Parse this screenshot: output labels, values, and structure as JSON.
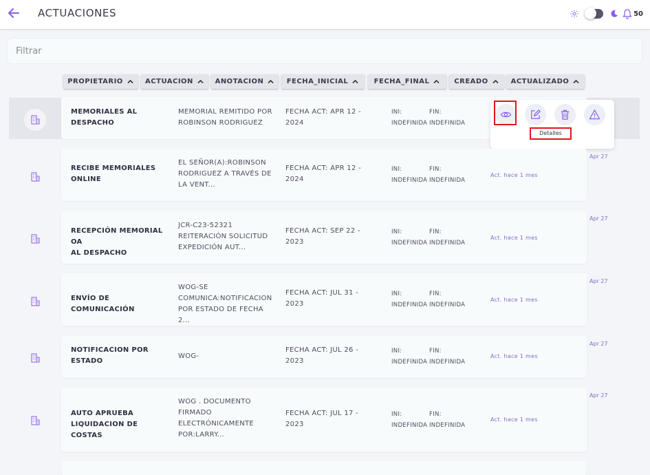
{
  "header": {
    "title": "ACTUACIONES",
    "notification_count": "50"
  },
  "filter": {
    "placeholder": "Filtrar"
  },
  "sort_headers": [
    "PROPIETARIO",
    "ACTUACION",
    "ANOTACION",
    "FECHA_INICIAL",
    "FECHA_FINAL",
    "CREADO",
    "ACTUALIZADO"
  ],
  "actions": {
    "tooltip": "Detalles"
  },
  "rows": [
    {
      "propietario": [
        "MEMORIALES AL",
        "DESPACHO"
      ],
      "actuacion": [
        "MEMORIAL REMITIDO POR",
        "ROBINSON RODRIGUEZ"
      ],
      "fecha": [
        "FECHA ACT: APR 12 -",
        "2024"
      ],
      "ini": [
        "INI:",
        "INDEFINIDA"
      ],
      "fin": [
        "FIN:",
        "INDEFINIDA"
      ],
      "updated": "",
      "date": ""
    },
    {
      "propietario": [
        "RECIBE MEMORIALES",
        "ONLINE"
      ],
      "actuacion": [
        "EL SEÑOR(A):ROBINSON",
        "RODRIGUEZ A TRAVÉS DE",
        "LA VENT..."
      ],
      "fecha": [
        "FECHA ACT: APR 12 -",
        "2024"
      ],
      "ini": [
        "INI:",
        "INDEFINIDA"
      ],
      "fin": [
        "FIN:",
        "INDEFINIDA"
      ],
      "updated": "Act. hace 1 mes",
      "date": "Apr 27"
    },
    {
      "propietario": [
        "RECEPCIÓN MEMORIAL OA",
        "AL DESPACHO"
      ],
      "actuacion": [
        "JCR-C23-52321",
        "REITERACIÓN SOLICITUD",
        "EXPEDICIÓN AUT..."
      ],
      "fecha": [
        "FECHA ACT: SEP 22 -",
        "2023"
      ],
      "ini": [
        "INI:",
        "INDEFINIDA"
      ],
      "fin": [
        "FIN:",
        "INDEFINIDA"
      ],
      "updated": "Act. hace 1 mes",
      "date": "Apr 27"
    },
    {
      "propietario": [
        "ENVÍO DE COMUNICACIÓN"
      ],
      "actuacion": [
        "WOG-SE",
        "COMUNICA:NOTIFICACION",
        "POR ESTADO DE FECHA 2..."
      ],
      "fecha": [
        "FECHA ACT: JUL 31 -",
        "2023"
      ],
      "ini": [
        "INI:",
        "INDEFINIDA"
      ],
      "fin": [
        "FIN:",
        "INDEFINIDA"
      ],
      "updated": "Act. hace 1 mes",
      "date": "Apr 27"
    },
    {
      "propietario": [
        "NOTIFICACION POR",
        "ESTADO"
      ],
      "actuacion": [
        "WOG-"
      ],
      "fecha": [
        "FECHA ACT: JUL 26 -",
        "2023"
      ],
      "ini": [
        "INI:",
        "INDEFINIDA"
      ],
      "fin": [
        "FIN:",
        "INDEFINIDA"
      ],
      "updated": "Act. hace 1 mes",
      "date": "Apr 27"
    },
    {
      "propietario": [
        "AUTO APRUEBA",
        "LIQUIDACION DE COSTAS"
      ],
      "actuacion": [
        "WOG . DOCUMENTO",
        "FIRMADO",
        "ELECTRÓNICAMENTE",
        "POR:LARRY..."
      ],
      "fecha": [
        "FECHA ACT: JUL 17 -",
        "2023"
      ],
      "ini": [
        "INI:",
        "INDEFINIDA"
      ],
      "fin": [
        "FIN:",
        "INDEFINIDA"
      ],
      "updated": "Act. hace 1 mes",
      "date": "Apr 27"
    }
  ]
}
